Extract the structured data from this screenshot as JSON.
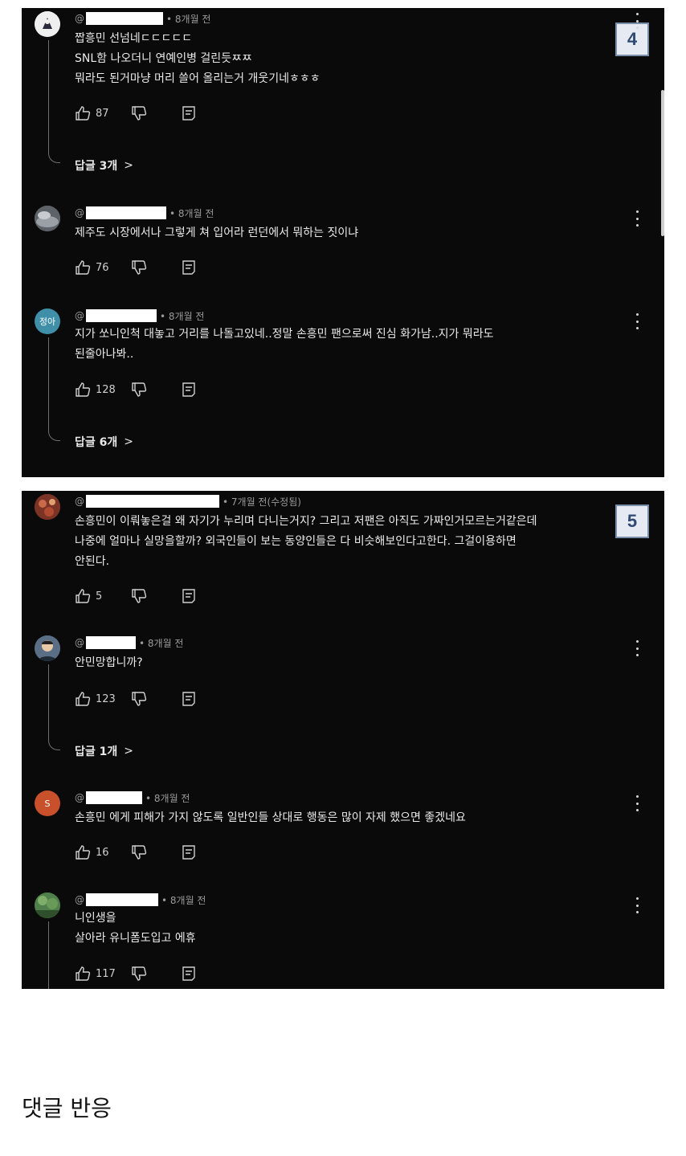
{
  "panels": [
    {
      "badge": "4",
      "comments": [
        {
          "time": "• 8개월 전",
          "lines": [
            "짭흥민 선넘네ㄷㄷㄷㄷㄷ",
            "SNL함 나오더니 연예인병 걸린듯ㅉㅉ",
            "뭐라도 된거마냥 머리 쓸어 올리는거 개웃기네ㅎㅎㅎ"
          ],
          "likes": "87",
          "replies": "답글 3개"
        },
        {
          "time": "• 8개월 전",
          "lines": [
            "제주도 시장에서나 그렇게 쳐 입어라 런던에서 뭐하는 짓이냐"
          ],
          "likes": "76"
        },
        {
          "avatar_text": "정아",
          "time": "• 8개월 전",
          "lines": [
            "지가 쏘니인척 대놓고 거리를 나돌고있네..정말 손흥민 팬으로써 진심 화가남..지가 뭐라도",
            "된줄아나봐.."
          ],
          "likes": "128",
          "replies": "답글 6개"
        }
      ]
    },
    {
      "badge": "5",
      "comments": [
        {
          "time": "• 7개월 전(수정됨)",
          "lines": [
            "손흥민이 이뤄놓은걸 왜 자기가 누리며 다니는거지? 그리고 저팬은 아직도 가짜인거모르는거같은데",
            "나중에 얼마나 실망을할까? 외국인들이 보는 동양인들은 다 비슷해보인다고한다. 그걸이용하면",
            "안된다."
          ],
          "likes": "5"
        },
        {
          "time": "• 8개월 전",
          "lines": [
            "안민망합니까?"
          ],
          "likes": "123",
          "replies": "답글 1개"
        },
        {
          "avatar_text": "S",
          "time": "• 8개월 전",
          "lines": [
            "손흥민 에게 피해가 가지 않도록 일반인들 상대로 행동은 많이 자제 했으면 좋겠네요"
          ],
          "likes": "16"
        },
        {
          "time": "• 8개월 전",
          "lines": [
            "니인생을",
            "살아라 유니폼도입고 에휴"
          ],
          "likes": "117"
        }
      ]
    }
  ],
  "handle_prefix": "@",
  "reply_chevron": ">",
  "section_title": "댓글 반응",
  "colors": {
    "panel_bg": "#0a0a0a",
    "text": "#eaeaea",
    "meta": "#9a9a9a",
    "badge_bg": "#e6ebf3",
    "badge_border": "#7b8ea8",
    "avatar_jeonga": "#3f8fa8",
    "avatar_s": "#c8502a"
  }
}
